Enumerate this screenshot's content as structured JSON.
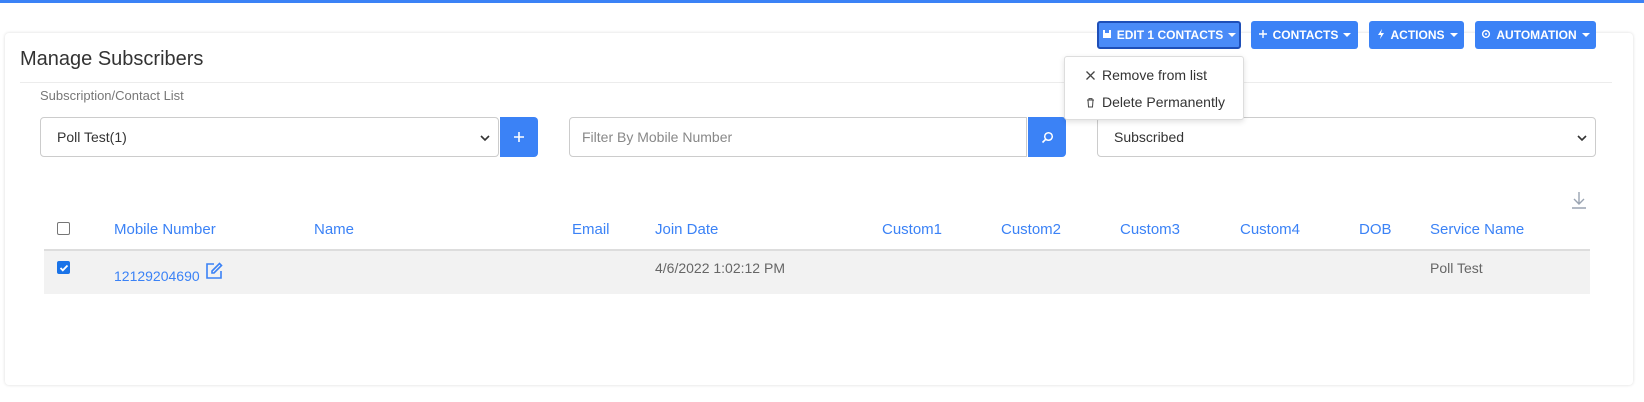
{
  "page": {
    "title": "Manage Subscribers"
  },
  "toolbar": {
    "edit_contacts": "EDIT 1 CONTACTS",
    "contacts": "CONTACTS",
    "actions": "ACTIONS",
    "automation": "AUTOMATION"
  },
  "dropdown": {
    "remove": "Remove from list",
    "delete": "Delete Permanently"
  },
  "filters": {
    "list_label": "Subscription/Contact List",
    "list_value": "Poll Test(1)",
    "mobile_placeholder": "Filter By Mobile Number",
    "status_value": "Subscribed"
  },
  "table": {
    "headers": [
      "Mobile Number",
      "Name",
      "Email",
      "Join Date",
      "Custom1",
      "Custom2",
      "Custom3",
      "Custom4",
      "DOB",
      "Service Name"
    ],
    "rows": [
      {
        "mobile": "12129204690",
        "name": "",
        "email": "",
        "join_date": "4/6/2022 1:02:12 PM",
        "custom1": "",
        "custom2": "",
        "custom3": "",
        "custom4": "",
        "dob": "",
        "service": "Poll Test"
      }
    ]
  },
  "colors": {
    "accent": "#3b82f6"
  }
}
